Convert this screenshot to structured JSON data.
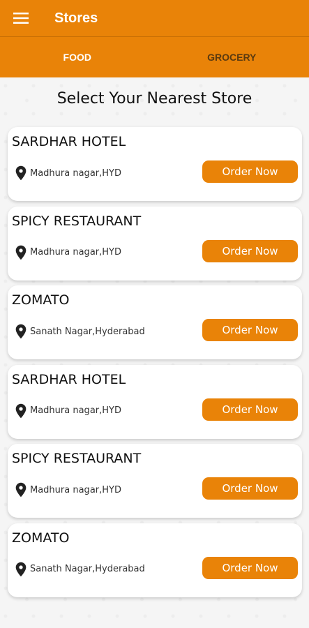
{
  "appbar": {
    "title": "Stores"
  },
  "tabs": [
    {
      "label": "FOOD",
      "active": true
    },
    {
      "label": "GROCERY",
      "active": false
    }
  ],
  "main": {
    "heading": "Select Your Nearest Store",
    "order_label": "Order Now",
    "stores": [
      {
        "name": "SARDHAR HOTEL",
        "address": "Madhura nagar,HYD"
      },
      {
        "name": "SPICY RESTAURANT",
        "address": "Madhura nagar,HYD"
      },
      {
        "name": "ZOMATO",
        "address": "Sanath Nagar,Hyderabad"
      },
      {
        "name": "SARDHAR HOTEL",
        "address": "Madhura nagar,HYD"
      },
      {
        "name": "SPICY RESTAURANT",
        "address": "Madhura nagar,HYD"
      },
      {
        "name": "ZOMATO",
        "address": "Sanath Nagar,Hyderabad"
      }
    ]
  },
  "icons": {
    "menu": "hamburger-menu-icon",
    "location": "location-pin-icon"
  },
  "colors": {
    "primary": "#e98308",
    "inactive_tab_text": "#5a3a10",
    "card_bg": "#ffffff"
  }
}
